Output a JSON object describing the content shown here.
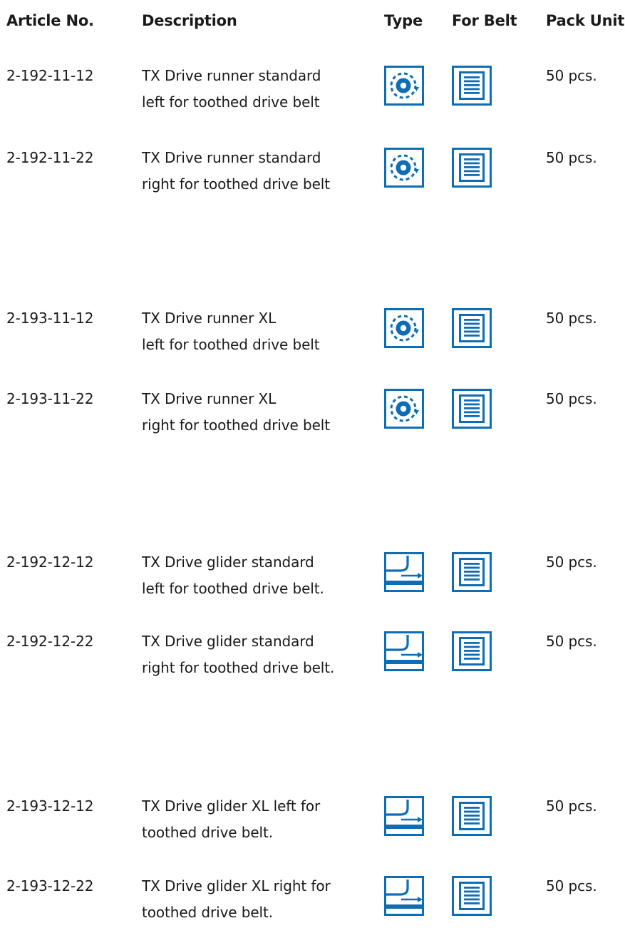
{
  "header": {
    "article_no": "Article No.",
    "description": "Description",
    "type": "Type",
    "for_belt": "For Belt",
    "pack_unit": "Pack Unit"
  },
  "colors": {
    "icon_blue": "#0f6db5",
    "text": "#1a1a1a"
  },
  "rows": [
    {
      "article": "2-192-11-12",
      "desc1": "TX Drive runner standard",
      "desc2": "left for toothed drive belt",
      "type_icon": "runner-icon",
      "belt_icon": "belt-document-icon",
      "pack": "50 pcs."
    },
    {
      "article": "2-192-11-22",
      "desc1": "TX Drive runner standard",
      "desc2": "right for toothed drive belt",
      "type_icon": "runner-icon",
      "belt_icon": "belt-document-icon",
      "pack": "50 pcs."
    },
    {
      "article": "2-193-11-12",
      "desc1": "TX Drive runner XL",
      "desc2": "left for toothed drive belt",
      "type_icon": "runner-icon",
      "belt_icon": "belt-document-icon",
      "pack": "50 pcs."
    },
    {
      "article": "2-193-11-22",
      "desc1": "TX Drive runner XL",
      "desc2": "right for toothed drive belt",
      "type_icon": "runner-icon",
      "belt_icon": "belt-document-icon",
      "pack": "50 pcs."
    },
    {
      "article": "2-192-12-12",
      "desc1": "TX Drive glider standard",
      "desc2": "left for toothed drive belt.",
      "type_icon": "glider-icon",
      "belt_icon": "belt-document-icon",
      "pack": "50 pcs."
    },
    {
      "article": "2-192-12-22",
      "desc1": "TX Drive glider standard",
      "desc2": "right for toothed drive belt.",
      "type_icon": "glider-icon",
      "belt_icon": "belt-document-icon",
      "pack": "50 pcs."
    },
    {
      "article": "2-193-12-12",
      "desc1": "TX Drive glider XL left for",
      "desc2": "toothed drive belt.",
      "type_icon": "glider-icon",
      "belt_icon": "belt-document-icon",
      "pack": "50 pcs."
    },
    {
      "article": "2-193-12-22",
      "desc1": "TX Drive glider XL right for",
      "desc2": "toothed drive belt.",
      "type_icon": "glider-icon",
      "belt_icon": "belt-document-icon",
      "pack": "50 pcs."
    }
  ]
}
